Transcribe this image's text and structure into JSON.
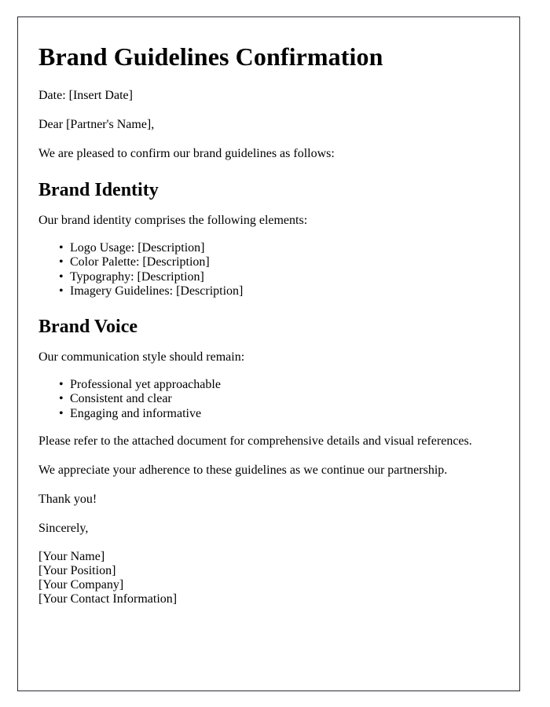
{
  "document": {
    "title": "Brand Guidelines Confirmation",
    "date_line": "Date: [Insert Date]",
    "salutation": "Dear [Partner's Name],",
    "intro": "We are pleased to confirm our brand guidelines as follows:",
    "sections": [
      {
        "heading": "Brand Identity",
        "intro": "Our brand identity comprises the following elements:",
        "items": [
          "Logo Usage: [Description]",
          "Color Palette: [Description]",
          "Typography: [Description]",
          "Imagery Guidelines: [Description]"
        ]
      },
      {
        "heading": "Brand Voice",
        "intro": "Our communication style should remain:",
        "items": [
          "Professional yet approachable",
          "Consistent and clear",
          "Engaging and informative"
        ]
      }
    ],
    "closing": {
      "attachment_note": "Please refer to the attached document for comprehensive details and visual references.",
      "appreciation": "We appreciate your adherence to these guidelines as we continue our partnership.",
      "thanks": "Thank you!",
      "signoff": "Sincerely,"
    },
    "signature": [
      "[Your Name]",
      "[Your Position]",
      "[Your Company]",
      "[Your Contact Information]"
    ]
  }
}
